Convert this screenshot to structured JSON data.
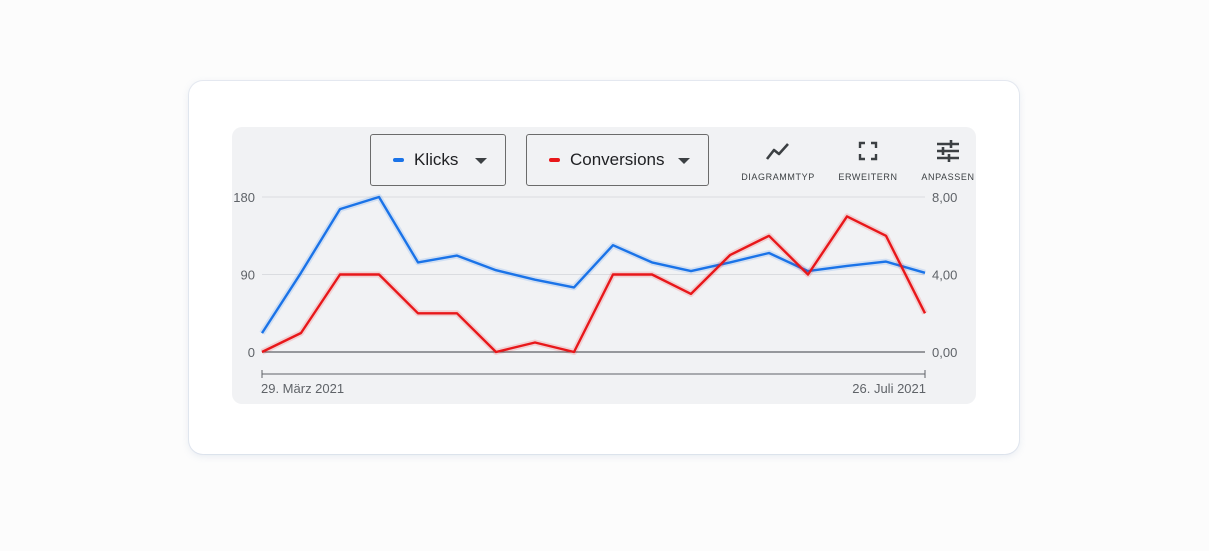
{
  "header": {
    "metric1": {
      "label": "Klicks",
      "color": "#1a73e8"
    },
    "metric2": {
      "label": "Conversions",
      "color": "#e8171a"
    }
  },
  "toolbar": {
    "chart_type_label": "DIAGRAMMTYP",
    "expand_label": "ERWEITERN",
    "customize_label": "ANPASSEN"
  },
  "chart_data": {
    "type": "line",
    "x_start_label": "29. März 2021",
    "x_end_label": "26. Juli 2021",
    "series": [
      {
        "name": "Klicks",
        "axis": "left",
        "color": "#1a73e8",
        "values": [
          22,
          92,
          166,
          180,
          104,
          112,
          95,
          84,
          75,
          124,
          104,
          94,
          104,
          115,
          94,
          100,
          105,
          92
        ]
      },
      {
        "name": "Conversions",
        "axis": "right",
        "color": "#e8171a",
        "values": [
          0,
          0.98,
          4.0,
          4.0,
          2.0,
          2.0,
          0,
          0.49,
          0,
          4.0,
          4.0,
          3.0,
          5.0,
          6.0,
          4.0,
          7.0,
          6.0,
          2.0
        ]
      }
    ],
    "y_left": {
      "ylim": [
        0,
        180
      ],
      "ticks": [
        0,
        90,
        180
      ],
      "tick_labels": [
        "0",
        "90",
        "180"
      ]
    },
    "y_right": {
      "ylim": [
        0,
        8
      ],
      "ticks": [
        0,
        4,
        8
      ],
      "tick_labels": [
        "0,00",
        "4,00",
        "8,00"
      ]
    },
    "grid": true
  }
}
